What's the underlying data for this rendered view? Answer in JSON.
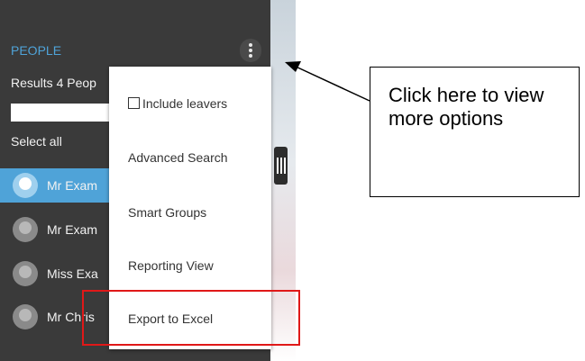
{
  "sidebar": {
    "section_title": "PEOPLE",
    "results_text": "Results 4 Peop",
    "search_value": "",
    "select_all": "Select all",
    "people": [
      {
        "name": "Mr Exam",
        "selected": true
      },
      {
        "name": "Mr Exam",
        "selected": false
      },
      {
        "name": "Miss Exa",
        "selected": false
      },
      {
        "name": "Mr Chris",
        "selected": false
      }
    ]
  },
  "menu": {
    "items": [
      {
        "label": "Include leavers",
        "type": "checkbox",
        "checked": false
      },
      {
        "label": "Advanced Search",
        "type": "item"
      },
      {
        "label": "Smart Groups",
        "type": "item"
      },
      {
        "label": "Reporting View",
        "type": "item"
      },
      {
        "label": "Export to Excel",
        "type": "item",
        "highlighted": true
      }
    ]
  },
  "annotation": {
    "callout_text": "Click here to view more options",
    "highlight_color": "#e01818"
  },
  "colors": {
    "sidebar_bg": "#3a3a3a",
    "accent": "#4fa3d8"
  }
}
